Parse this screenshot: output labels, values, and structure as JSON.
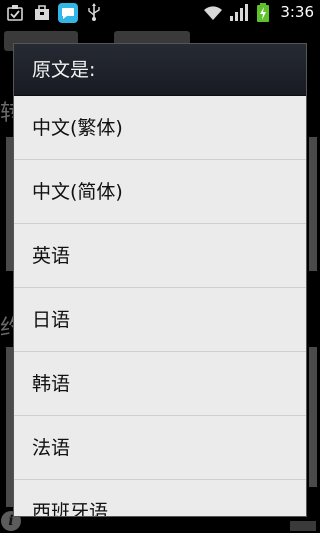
{
  "status_bar": {
    "time": "3:36",
    "icons": [
      "check-notification-icon",
      "shopping-bag-icon",
      "chat-bubble-icon",
      "usb-icon",
      "wifi-icon",
      "signal-icon",
      "battery-charging-icon"
    ],
    "accent_color": "#33b5e5",
    "battery_color": "#5fc12b"
  },
  "background": {
    "visible_chars": [
      "转",
      "约"
    ],
    "info_icon_glyph": "i"
  },
  "dialog": {
    "title": "原文是:",
    "options": [
      {
        "label": "中文(繁体)"
      },
      {
        "label": "中文(简体)"
      },
      {
        "label": "英语"
      },
      {
        "label": "日语"
      },
      {
        "label": "韩语"
      },
      {
        "label": "法语"
      },
      {
        "label": "西班牙语"
      }
    ]
  }
}
